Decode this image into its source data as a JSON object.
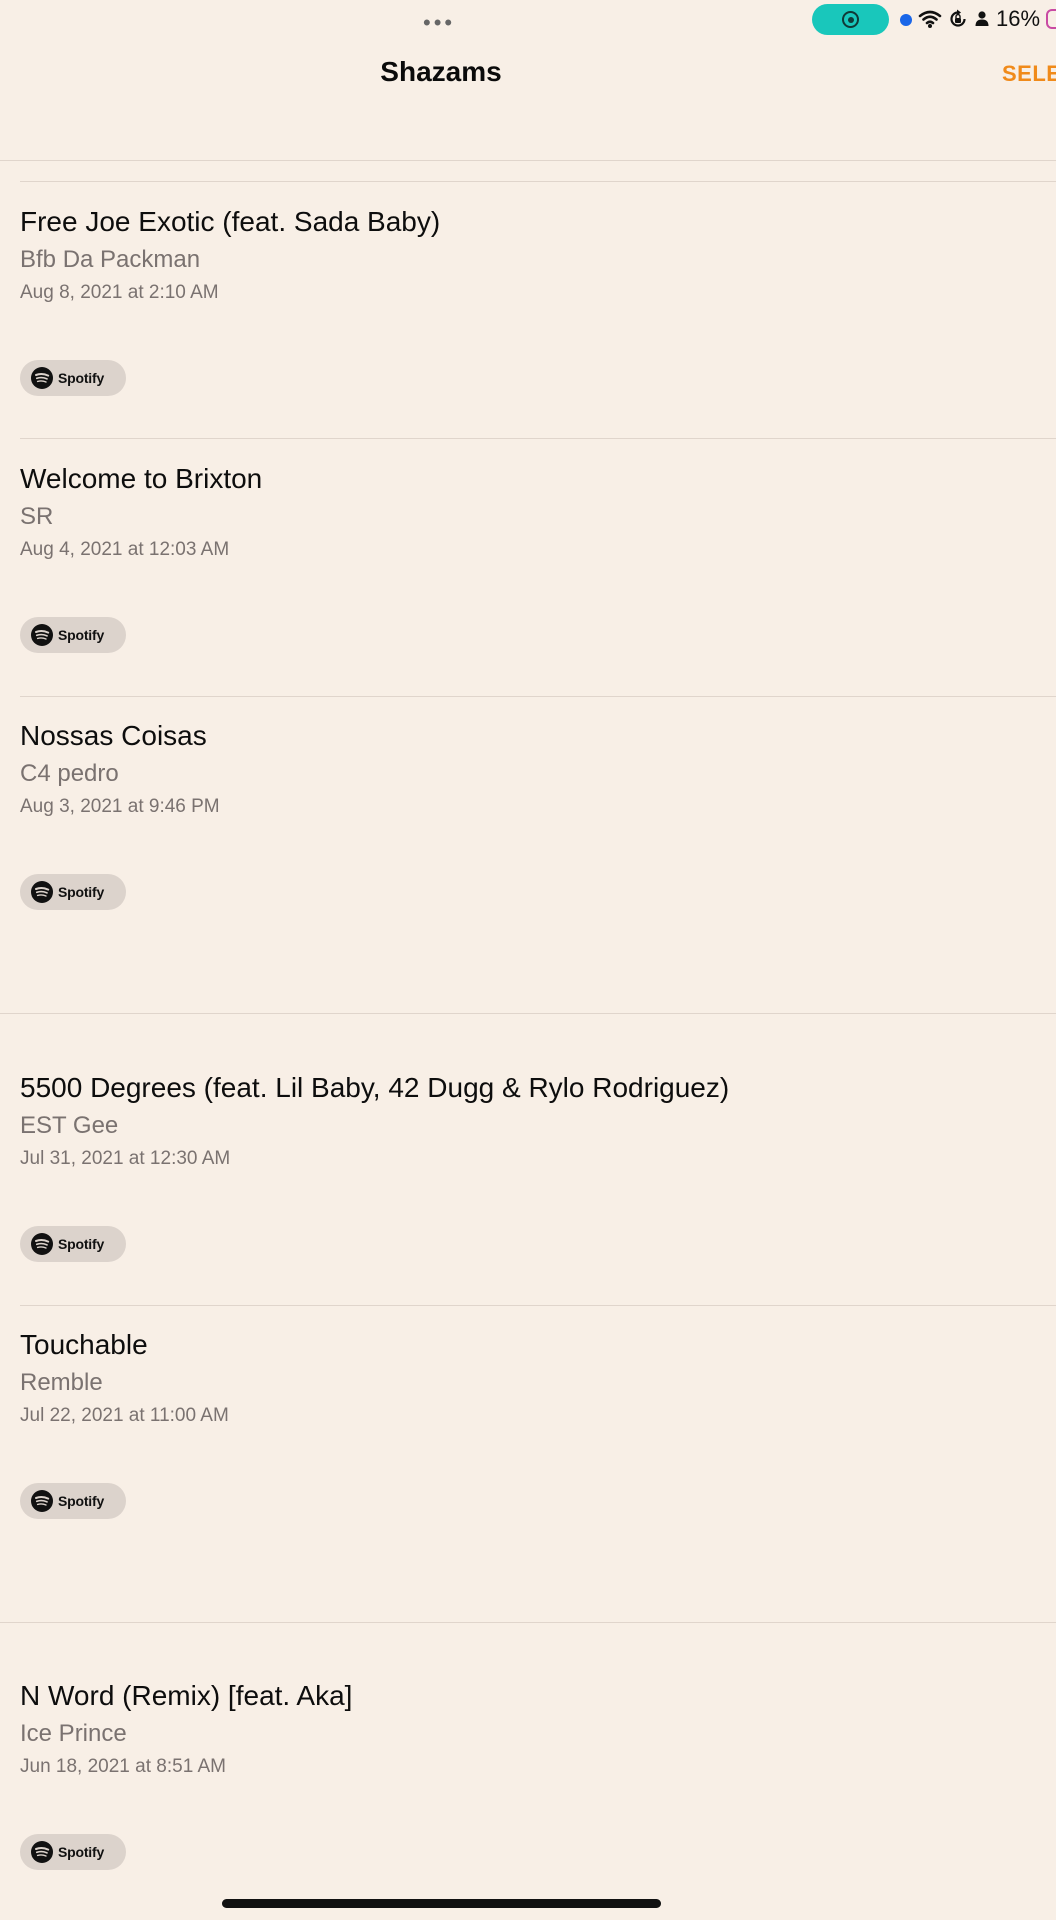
{
  "status_bar": {
    "more_icon": "ellipsis-icon",
    "record_icon": "screen-record-icon",
    "record_color": "#19c7bb",
    "indicator_color": "#1a66e8",
    "battery_percent": "16%",
    "battery_color": "#c94aa3"
  },
  "header": {
    "title": "Shazams",
    "select_label": "SELE",
    "accent_color": "#f08a1a"
  },
  "shazams": [
    {
      "title": "Free Joe Exotic (feat. Sada Baby)",
      "artist": "Bfb Da Packman",
      "date": "Aug 8, 2021 at 2:10 AM",
      "service": "Spotify"
    },
    {
      "title": "Welcome to Brixton",
      "artist": "SR",
      "date": "Aug 4, 2021 at 12:03 AM",
      "service": "Spotify"
    },
    {
      "title": "Nossas Coisas",
      "artist": "C4 pedro",
      "date": "Aug 3, 2021 at 9:46 PM",
      "service": "Spotify"
    },
    {
      "title": "5500 Degrees (feat. Lil Baby, 42 Dugg & Rylo Rodriguez)",
      "artist": "EST Gee",
      "date": "Jul 31, 2021 at 12:30 AM",
      "service": "Spotify"
    },
    {
      "title": "Touchable",
      "artist": "Remble",
      "date": "Jul 22, 2021 at 11:00 AM",
      "service": "Spotify"
    },
    {
      "title": "N Word (Remix) [feat. Aka]",
      "artist": "Ice Prince",
      "date": "Jun 18, 2021 at 8:51 AM",
      "service": "Spotify"
    }
  ]
}
